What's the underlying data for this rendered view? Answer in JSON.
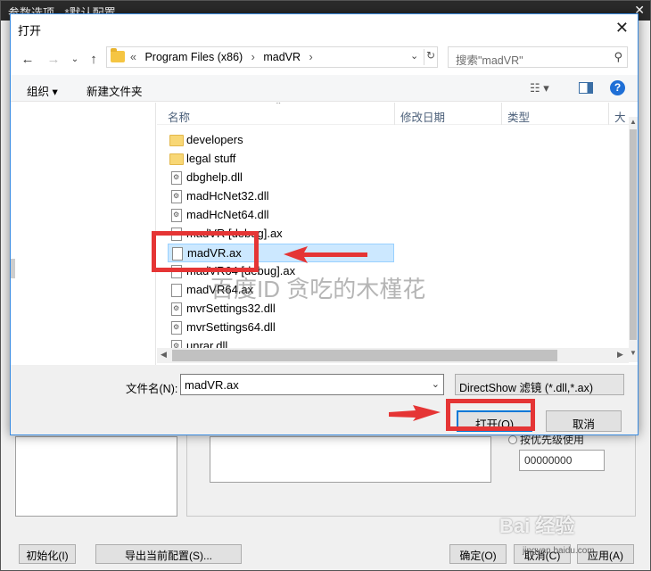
{
  "background_window": {
    "title": "参数选项 - *默认配置",
    "radio_label": "按优先级使用",
    "value_field": "00000000",
    "buttons": {
      "init": "初始化(I)",
      "export": "导出当前配置(S)...",
      "ok": "确定(O)",
      "cancel": "取消(C)",
      "apply": "应用(A)"
    }
  },
  "dialog": {
    "title": "打开",
    "close_glyph": "✕",
    "address": {
      "overflow": "«",
      "parts": [
        "Program Files (x86)",
        "madVR"
      ],
      "separator": "›"
    },
    "search": {
      "placeholder": "搜索\"madVR\""
    },
    "toolbar": {
      "organize": "组织 ▾",
      "new_folder": "新建文件夹",
      "help": "?"
    },
    "columns": {
      "name": "名称",
      "modified": "修改日期",
      "type": "类型",
      "size": "大"
    },
    "files": [
      {
        "name": "developers",
        "kind": "folder",
        "selected": false
      },
      {
        "name": "legal stuff",
        "kind": "folder",
        "selected": false
      },
      {
        "name": "dbghelp.dll",
        "kind": "dll",
        "selected": false
      },
      {
        "name": "madHcNet32.dll",
        "kind": "dll",
        "selected": false
      },
      {
        "name": "madHcNet64.dll",
        "kind": "dll",
        "selected": false
      },
      {
        "name": "madVR [debug].ax",
        "kind": "file",
        "selected": false
      },
      {
        "name": "madVR.ax",
        "kind": "file",
        "selected": true
      },
      {
        "name": "madVR64 [debug].ax",
        "kind": "file",
        "selected": false
      },
      {
        "name": "madVR64.ax",
        "kind": "file",
        "selected": false
      },
      {
        "name": "mvrSettings32.dll",
        "kind": "dll",
        "selected": false
      },
      {
        "name": "mvrSettings64.dll",
        "kind": "dll",
        "selected": false
      },
      {
        "name": "unrar.dll",
        "kind": "dll",
        "selected": false
      }
    ],
    "filename": {
      "label": "文件名(N):",
      "value": "madVR.ax"
    },
    "filter": "DirectShow 滤镜 (*.dll,*.ax)",
    "open_button": "打开(O)",
    "cancel_button": "取消"
  },
  "watermark": "百度ID 贪吃的木槿花",
  "baidu_logo": "Bai 经验",
  "baidu_sub": "jingyan.baidu.com",
  "colors": {
    "annotation_red": "#e53535",
    "selection": "#cce8ff",
    "accent": "#0078d7"
  }
}
